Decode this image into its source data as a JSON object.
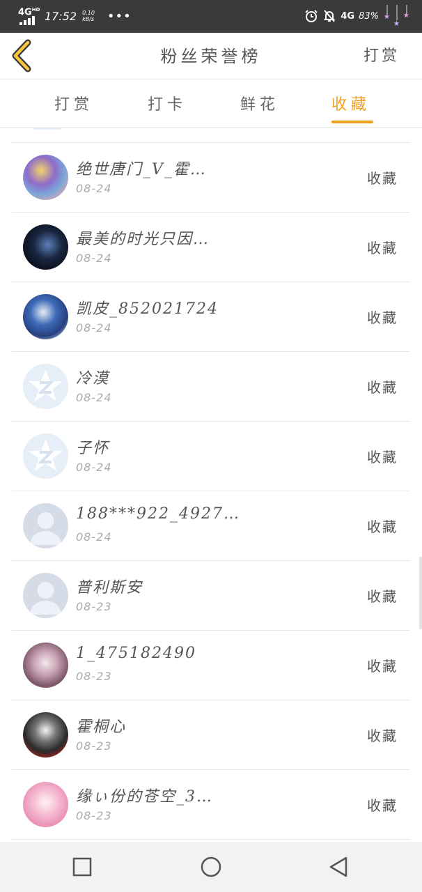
{
  "status_bar": {
    "network": "4G",
    "network_sup": "HD",
    "time": "17:52",
    "speed_value": "0.10",
    "speed_unit": "kB/s",
    "more": "•••",
    "network_right": "4G",
    "battery": "83%"
  },
  "header": {
    "title": "粉丝荣誉榜",
    "action_label": "打赏"
  },
  "tabs": [
    {
      "label": "打赏",
      "active": false
    },
    {
      "label": "打卡",
      "active": false
    },
    {
      "label": "鲜花",
      "active": false
    },
    {
      "label": "收藏",
      "active": true
    }
  ],
  "colors": {
    "accent": "#f0a020",
    "status_bar_bg": "#3a3a3a"
  },
  "list": {
    "items": [
      {
        "name": "绝世唐门_V_霍…",
        "date": "08-24",
        "action": "收藏",
        "avatar": "anime-avatar"
      },
      {
        "name": "最美的时光只因…",
        "date": "08-24",
        "action": "收藏",
        "avatar": "anime-avatar"
      },
      {
        "name": "凯皮_852021724",
        "date": "08-24",
        "action": "收藏",
        "avatar": "anime-avatar"
      },
      {
        "name": "冷漠",
        "date": "08-24",
        "action": "收藏",
        "avatar": "qq-default-avatar"
      },
      {
        "name": "子怀",
        "date": "08-24",
        "action": "收藏",
        "avatar": "qq-default-avatar"
      },
      {
        "name": "188***922_4927…",
        "date": "08-24",
        "action": "收藏",
        "avatar": "default-person-avatar"
      },
      {
        "name": "普利斯安",
        "date": "08-23",
        "action": "收藏",
        "avatar": "default-person-avatar"
      },
      {
        "name": "1_475182490",
        "date": "08-23",
        "action": "收藏",
        "avatar": "anime-avatar"
      },
      {
        "name": "霍桐心",
        "date": "08-23",
        "action": "收藏",
        "avatar": "anime-avatar"
      },
      {
        "name": "缘ぃ份的苍空_3…",
        "date": "08-23",
        "action": "收藏",
        "avatar": "anime-avatar"
      }
    ]
  },
  "nav_bar": {
    "icons": [
      "recent-apps-icon",
      "home-icon",
      "back-icon"
    ]
  }
}
